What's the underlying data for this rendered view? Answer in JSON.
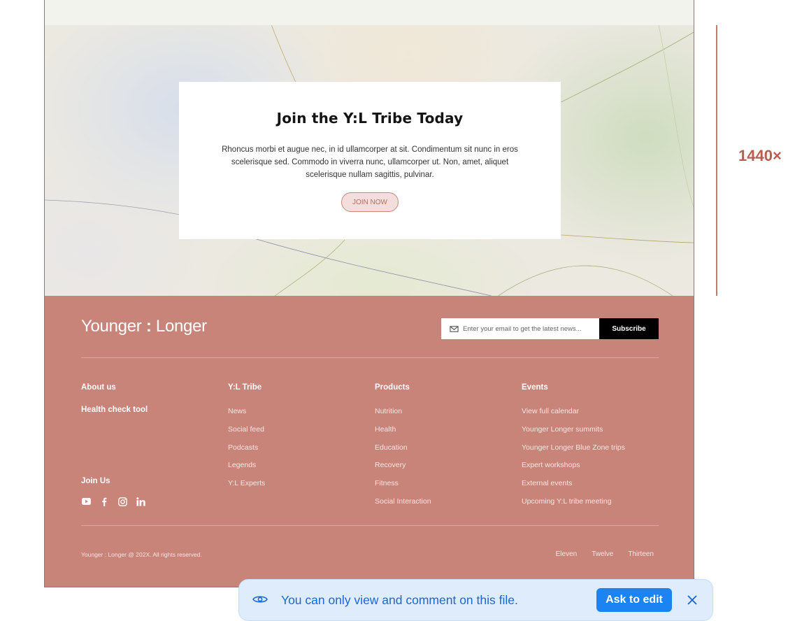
{
  "cta": {
    "title": "Join the Y:L Tribe Today",
    "body": "Rhoncus morbi et augue nec, in id ullamcorper at sit. Condimentum sit nunc in eros scelerisque sed. Commodo in viverra nunc, ullamcorper ut. Non, amet, aliquet scelerisque nullam sagittis, pulvinar.",
    "button": "JOIN NOW"
  },
  "footer": {
    "logo_left": "Younger",
    "logo_colon": ":",
    "logo_right": "Longer",
    "email_placeholder": "Enter your email to get the latest news...",
    "subscribe": "Subscribe",
    "about": "About us",
    "health_tool": "Health check tool",
    "join_us": "Join Us",
    "columns": [
      {
        "title": "Y:L Tribe",
        "items": [
          "News",
          "Social feed",
          "Podcasts",
          "Legends",
          "Y:L Experts"
        ]
      },
      {
        "title": "Products",
        "items": [
          "Nutrition",
          "Health",
          "Education",
          "Recovery",
          "Fitness",
          "Social Interaction"
        ]
      },
      {
        "title": "Events",
        "items": [
          "View full calendar",
          "Younger Longer summits",
          "Younger Longer Blue Zone trips",
          "Expert workshops",
          "External events",
          "Upcoming Y:L tribe meeting"
        ]
      }
    ],
    "socials": [
      "youtube-icon",
      "facebook-icon",
      "instagram-icon",
      "linkedin-icon"
    ],
    "copyright": "Younger : Longer @ 202X. All rights reserved.",
    "legal": [
      "Eleven",
      "Twelve",
      "Thirteen"
    ]
  },
  "measure": {
    "label": "1440×"
  },
  "banner": {
    "text": "You can only view and comment on this file.",
    "button": "Ask to edit"
  },
  "colors": {
    "footer_bg": "#c9847a",
    "accent": "#b75f50",
    "banner_bg": "#deecfb",
    "banner_button": "#1b84f2"
  }
}
